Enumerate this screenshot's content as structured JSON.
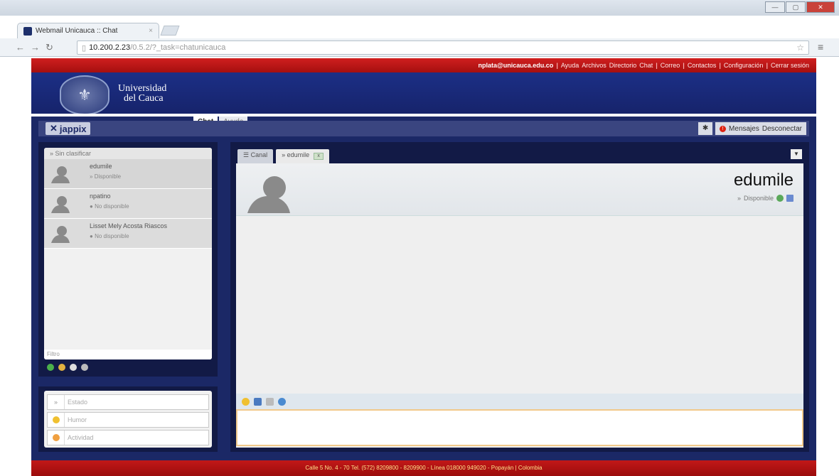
{
  "browser": {
    "tab_title": "Webmail Unicauca :: Chat",
    "url_host": "10.200.2.23",
    "url_path": "/0.5.2/?_task=chatunicauca"
  },
  "topbar": {
    "email": "nplata@unicauca.edu.co",
    "links": [
      "Ayuda",
      "Archivos",
      "Directorio",
      "Chat",
      "Correo",
      "Contactos",
      "Configuración",
      "Cerrar sesión"
    ]
  },
  "header": {
    "university_line1": "Universidad",
    "university_line2": "del Cauca",
    "tabs": [
      "Chat",
      "Ayuda"
    ]
  },
  "jappix": {
    "logo": "jappix",
    "messages_label": "Mensajes",
    "disconnect_label": "Desconectar"
  },
  "roster": {
    "group": "Sin clasificar",
    "buddies": [
      {
        "name": "edumile",
        "status": "Disponible"
      },
      {
        "name": "npatino",
        "status": "No disponible"
      },
      {
        "name": "Lisset Mely Acosta Riascos",
        "status": "No disponible"
      }
    ],
    "filter_placeholder": "Filtro"
  },
  "presence": {
    "estado": "Estado",
    "humor": "Humor",
    "actividad": "Actividad"
  },
  "chat": {
    "tabs": [
      "Canal",
      "edumile"
    ],
    "contact_name": "edumile",
    "contact_status": "Disponible"
  },
  "footer": {
    "text": "Calle 5 No. 4 - 70 Tel. (572) 8209800 - 8209900 - Línea 018000 949020 - Popayán | Colombia"
  },
  "colors": {
    "navy": "#1b2866",
    "red": "#b81414",
    "input_border": "#f1c98a"
  }
}
